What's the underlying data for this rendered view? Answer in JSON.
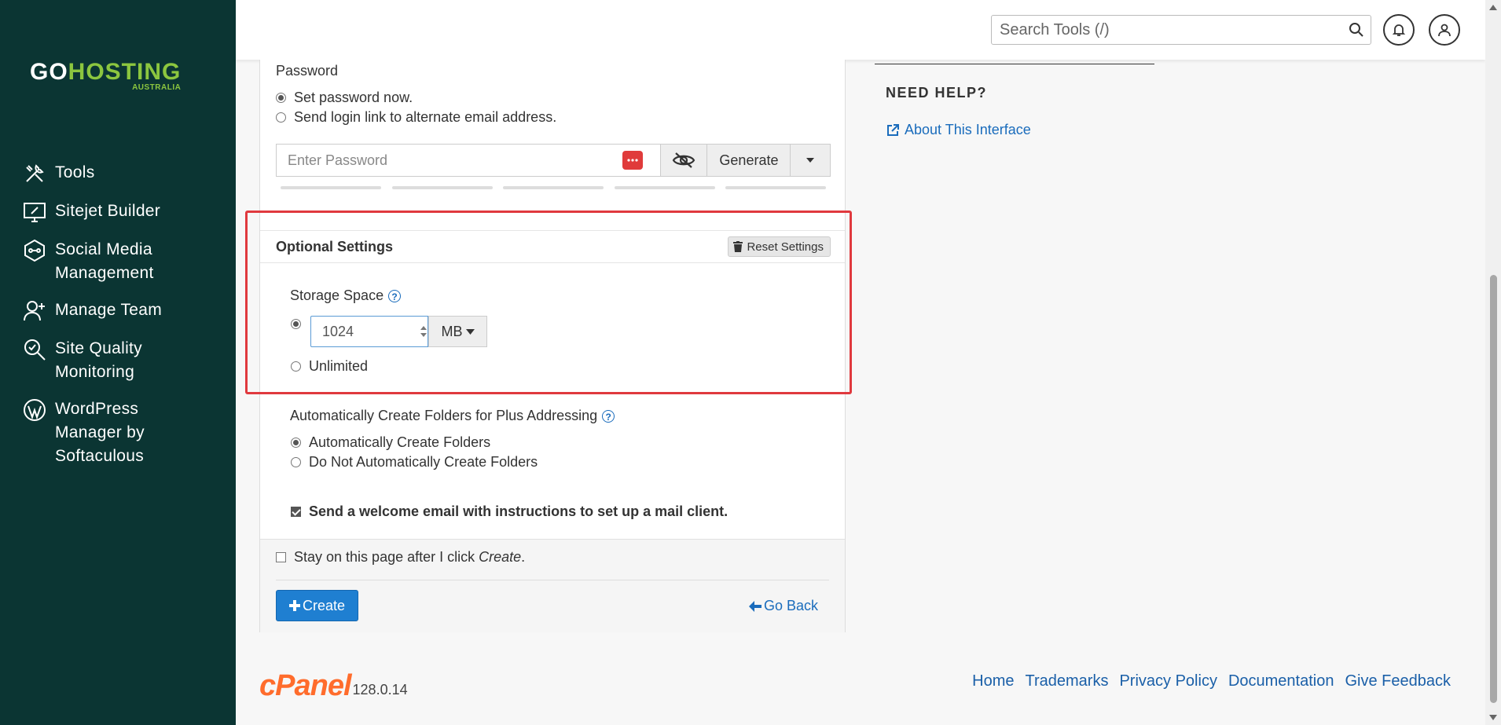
{
  "brand": {
    "logo_go": "GO",
    "logo_hosting": "HOSTING",
    "logo_sub": "AUSTRALIA"
  },
  "sidebar": {
    "items": [
      {
        "label": "Tools",
        "icon": "tools-icon"
      },
      {
        "label": "Sitejet Builder",
        "icon": "monitor-builder-icon"
      },
      {
        "label": "Social Media Management",
        "icon": "social-media-icon"
      },
      {
        "label": "Manage Team",
        "icon": "add-user-icon"
      },
      {
        "label": "Site Quality Monitoring",
        "icon": "search-quality-icon"
      },
      {
        "label": "WordPress Manager by Softaculous",
        "icon": "wordpress-icon"
      }
    ]
  },
  "header": {
    "search_placeholder": "Search Tools (/)"
  },
  "password": {
    "label": "Password",
    "option_set": "Set password now.",
    "option_link": "Send login link to alternate email address.",
    "placeholder": "Enter Password",
    "generate_label": "Generate"
  },
  "optional": {
    "title": "Optional Settings",
    "reset_label": "Reset Settings",
    "storage_label": "Storage Space",
    "storage_value": "1024",
    "storage_unit": "MB",
    "unlimited_label": "Unlimited",
    "plus_label": "Automatically Create Folders for Plus Addressing",
    "plus_auto": "Automatically Create Folders",
    "plus_no": "Do Not Automatically Create Folders",
    "welcome_label": "Send a welcome email with instructions to set up a mail client."
  },
  "actions": {
    "stay_prefix": "Stay on this page after I click ",
    "stay_em": "Create",
    "stay_suffix": ".",
    "create_label": "Create",
    "goback_label": "Go Back"
  },
  "help": {
    "title": "NEED HELP?",
    "about_link": "About This Interface"
  },
  "footer": {
    "cpanel_mark": "cPanel",
    "version": "128.0.14",
    "links": [
      "Home",
      "Trademarks",
      "Privacy Policy",
      "Documentation",
      "Give Feedback"
    ]
  },
  "colors": {
    "sidebar_bg": "#0b3533",
    "brand_green": "#8cc63f",
    "primary_blue": "#1f7fd1",
    "link_blue": "#1a6cbc",
    "highlight_red": "#e0393e",
    "cpanel_orange": "#ff6c2c"
  }
}
